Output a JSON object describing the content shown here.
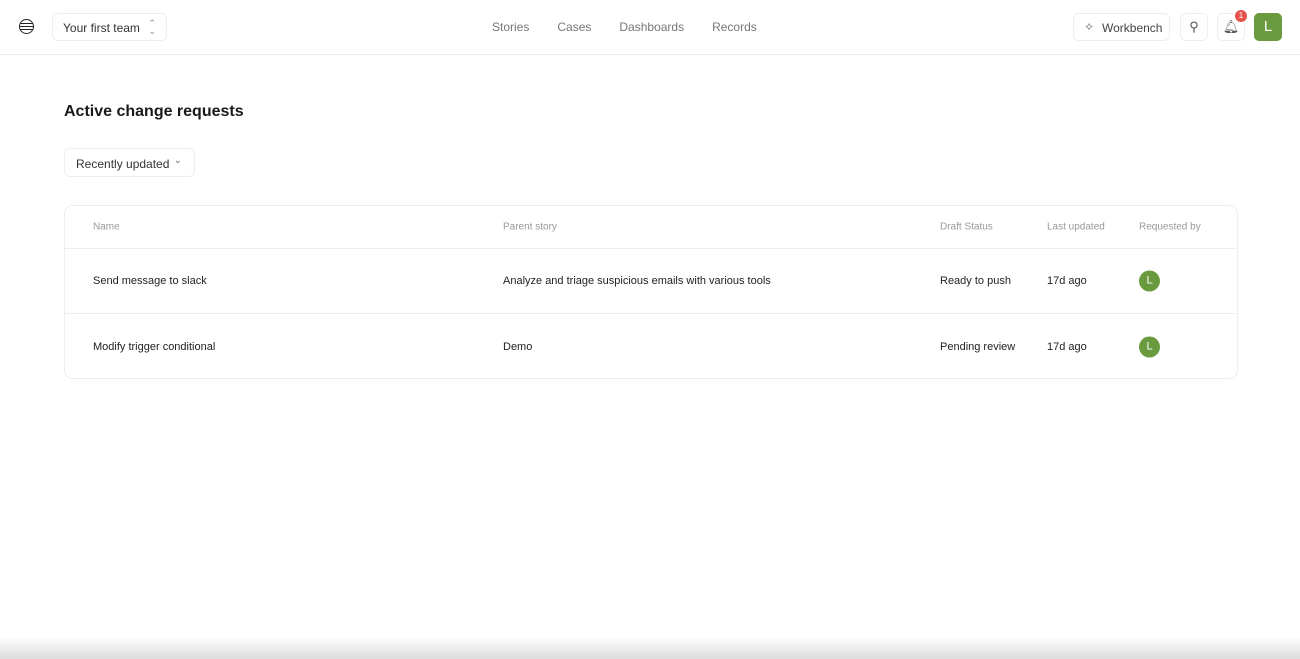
{
  "header": {
    "team": "Your first team",
    "nav": [
      "Stories",
      "Cases",
      "Dashboards",
      "Records"
    ],
    "workbench": "Workbench",
    "notifications": "1",
    "avatar": "L"
  },
  "page": {
    "title": "Active change requests",
    "sort": "Recently updated"
  },
  "table": {
    "columns": [
      "Name",
      "Parent story",
      "Draft Status",
      "Last updated",
      "Requested by"
    ],
    "rows": [
      {
        "name": "Send message to slack",
        "story": "Analyze and triage suspicious emails with various tools",
        "status": "Ready to push",
        "updated": "17d ago",
        "by": "L"
      },
      {
        "name": "Modify trigger conditional",
        "story": "Demo",
        "status": "Pending review",
        "updated": "17d ago",
        "by": "L"
      }
    ]
  }
}
